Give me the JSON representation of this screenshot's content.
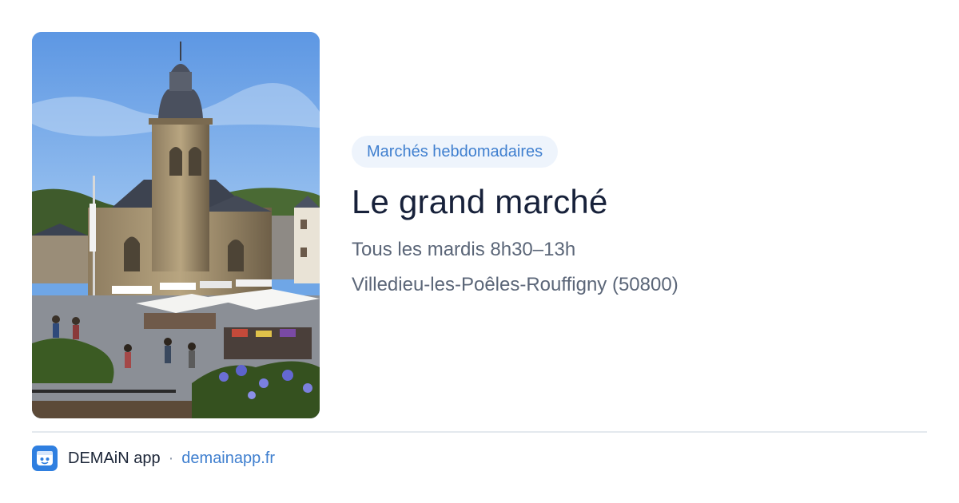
{
  "photo": {
    "alt_subject": "church-market-square"
  },
  "category": {
    "label": "Marchés hebdomadaires"
  },
  "event": {
    "title": "Le grand marché",
    "schedule": "Tous les mardis 8h30–13h",
    "location": "Villedieu-les-Poêles-Rouffigny (50800)"
  },
  "footer": {
    "brand": "DEMAiN app",
    "separator": "·",
    "site": "demainapp.fr",
    "logo_icon": "demain-app-icon"
  },
  "colors": {
    "accent": "#3f7fcf",
    "pill_bg": "#eef4fc",
    "title": "#17213a",
    "muted": "#5b6678",
    "divider": "#e4e9ee",
    "logo_bg": "#2f7fe0"
  }
}
